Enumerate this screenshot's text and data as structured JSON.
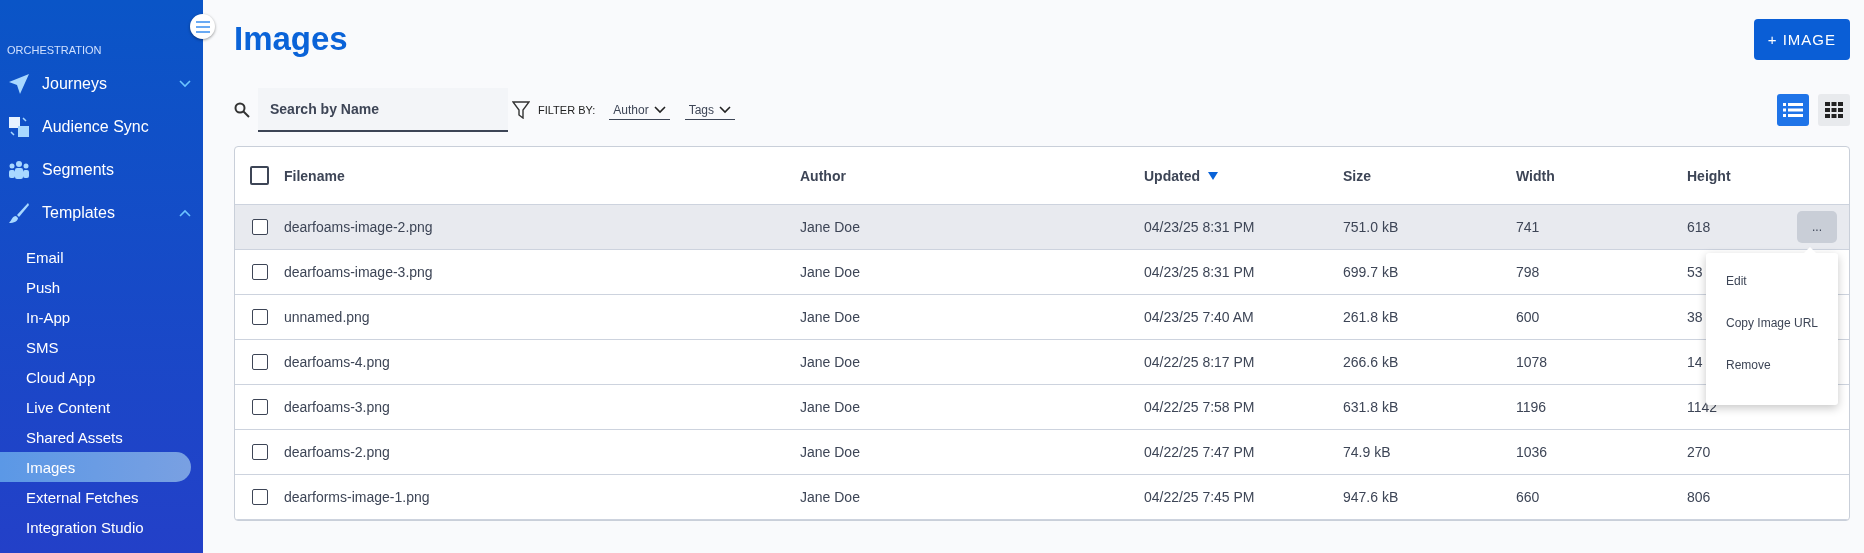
{
  "sidebar": {
    "section_title": "ORCHESTRATION",
    "items": [
      {
        "label": "Journeys",
        "kind": "plane",
        "expanded": false
      },
      {
        "label": "Audience Sync",
        "kind": "sync"
      },
      {
        "label": "Segments",
        "kind": "people"
      },
      {
        "label": "Templates",
        "kind": "brush",
        "expanded": true,
        "children": [
          {
            "label": "Email",
            "selected": false
          },
          {
            "label": "Push",
            "selected": false
          },
          {
            "label": "In-App",
            "selected": false
          },
          {
            "label": "SMS",
            "selected": false
          },
          {
            "label": "Cloud App",
            "selected": false
          },
          {
            "label": "Live Content",
            "selected": false
          },
          {
            "label": "Shared Assets",
            "selected": false
          },
          {
            "label": "Images",
            "selected": true
          },
          {
            "label": "External Fetches",
            "selected": false
          },
          {
            "label": "Integration Studio",
            "selected": false
          }
        ]
      }
    ]
  },
  "page_title": "Images",
  "add_button": "+ IMAGE",
  "search": {
    "placeholder": "Search by Name"
  },
  "filter": {
    "label": "FILTER BY:",
    "dropdowns": [
      "Author",
      "Tags"
    ]
  },
  "view_toggle": [
    {
      "kind": "list",
      "selected": true
    },
    {
      "kind": "grid",
      "selected": false
    }
  ],
  "table": {
    "select_all_checked": false,
    "columns": [
      {
        "label": "Filename",
        "sorted_descending": false
      },
      {
        "label": "Author",
        "sorted_descending": false
      },
      {
        "label": "Updated",
        "sorted_descending": true
      },
      {
        "label": "Size",
        "sorted_descending": false
      },
      {
        "label": "Width",
        "sorted_descending": false
      },
      {
        "label": "Height",
        "sorted_descending": false
      }
    ],
    "rows": [
      {
        "checked": false,
        "hovered": true,
        "actions": "...",
        "cells": [
          "dearfoams-image-2.png",
          "Jane Doe",
          "04/23/25 8:31 PM",
          "751.0 kB",
          "741",
          "618"
        ]
      },
      {
        "checked": false,
        "hovered": false,
        "cells": [
          "dearfoams-image-3.png",
          "Jane Doe",
          "04/23/25 8:31 PM",
          "699.7 kB",
          "798",
          "53"
        ]
      },
      {
        "checked": false,
        "hovered": false,
        "cells": [
          "unnamed.png",
          "Jane Doe",
          "04/23/25 7:40 AM",
          "261.8 kB",
          "600",
          "38"
        ]
      },
      {
        "checked": false,
        "hovered": false,
        "cells": [
          "dearfoams-4.png",
          "Jane Doe",
          "04/22/25 8:17 PM",
          "266.6 kB",
          "1078",
          "14"
        ]
      },
      {
        "checked": false,
        "hovered": false,
        "cells": [
          "dearfoams-3.png",
          "Jane Doe",
          "04/22/25 7:58 PM",
          "631.8 kB",
          "1196",
          "1142"
        ]
      },
      {
        "checked": false,
        "hovered": false,
        "cells": [
          "dearfoams-2.png",
          "Jane Doe",
          "04/22/25 7:47 PM",
          "74.9 kB",
          "1036",
          "270"
        ]
      },
      {
        "checked": false,
        "hovered": false,
        "cells": [
          "dearforms-image-1.png",
          "Jane Doe",
          "04/22/25 7:45 PM",
          "947.6 kB",
          "660",
          "806"
        ]
      }
    ]
  },
  "row_menu": {
    "items": [
      "Edit",
      "Copy Image URL",
      "Remove"
    ]
  }
}
